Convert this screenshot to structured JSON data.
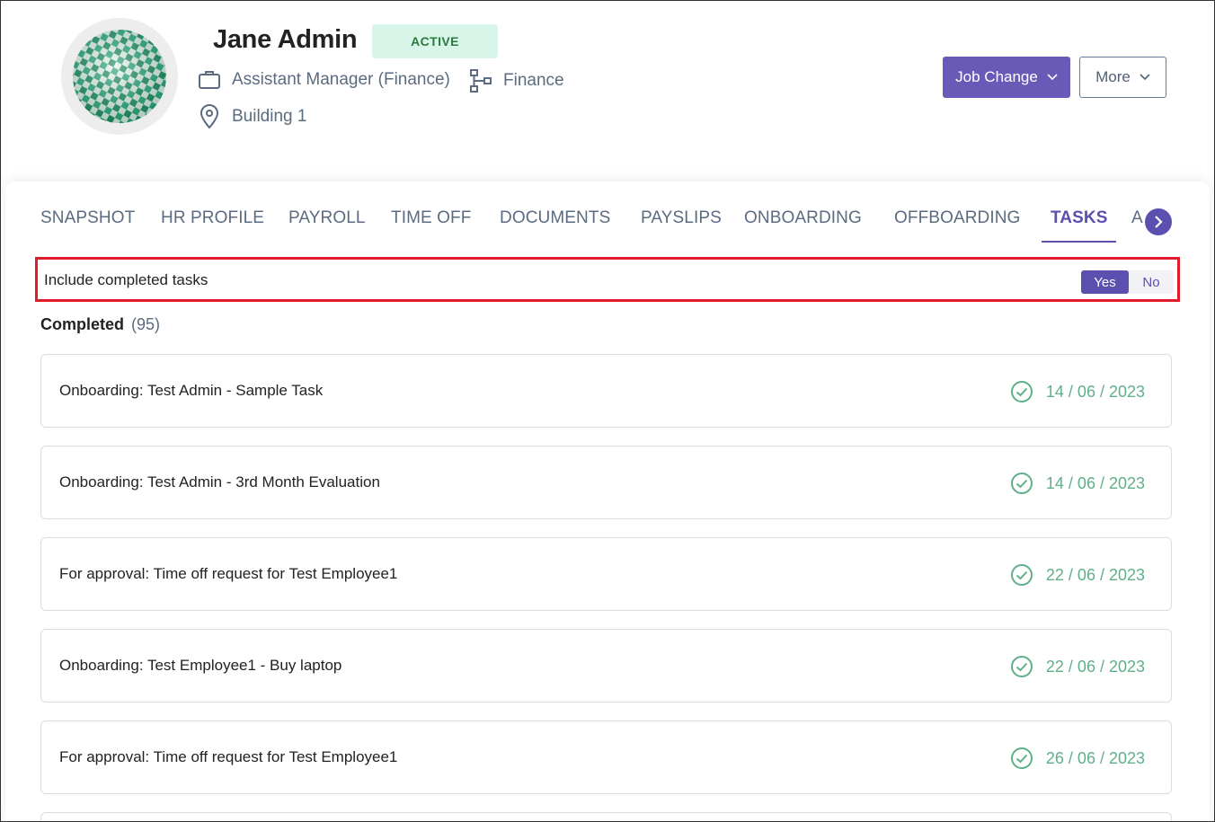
{
  "profile": {
    "name": "Jane Admin",
    "status": "ACTIVE",
    "position": "Assistant Manager (Finance)",
    "department": "Finance",
    "location": "Building 1"
  },
  "actions": {
    "job_change_label": "Job Change",
    "more_label": "More"
  },
  "tabs": [
    {
      "label": "SNAPSHOT",
      "active": false
    },
    {
      "label": "HR PROFILE",
      "active": false
    },
    {
      "label": "PAYROLL",
      "active": false
    },
    {
      "label": "TIME OFF",
      "active": false
    },
    {
      "label": "DOCUMENTS",
      "active": false
    },
    {
      "label": "PAYSLIPS",
      "active": false
    },
    {
      "label": "ONBOARDING",
      "active": false
    },
    {
      "label": "OFFBOARDING",
      "active": false
    },
    {
      "label": "TASKS",
      "active": true
    },
    {
      "label": "A",
      "active": false
    }
  ],
  "filter": {
    "label": "Include completed tasks",
    "yes_label": "Yes",
    "no_label": "No",
    "selected": "Yes"
  },
  "completed_section": {
    "heading": "Completed",
    "count": "(95)"
  },
  "tasks": [
    {
      "title": "Onboarding: Test Admin - Sample Task",
      "date": "14 / 06 / 2023"
    },
    {
      "title": "Onboarding: Test Admin - 3rd Month Evaluation",
      "date": "14 / 06 / 2023"
    },
    {
      "title": "For approval: Time off request for Test Employee1",
      "date": "22 / 06 / 2023"
    },
    {
      "title": "Onboarding: Test Employee1 - Buy laptop",
      "date": "22 / 06 / 2023"
    },
    {
      "title": "For approval: Time off request for Test Employee1",
      "date": "26 / 06 / 2023"
    }
  ],
  "colors": {
    "accent": "#5b4fb0",
    "button": "#6a5ab8",
    "status_bg": "#d7f5e8",
    "status_text": "#2a7a3d",
    "complete_green": "#5fb08a",
    "highlight_red": "#e11b2a"
  },
  "icons": {
    "position": "briefcase-icon",
    "department": "org-chart-icon",
    "location": "map-pin-icon",
    "dropdown": "chevron-down-icon",
    "tabs_next": "chevron-right-icon",
    "completed": "check-circle-icon"
  }
}
